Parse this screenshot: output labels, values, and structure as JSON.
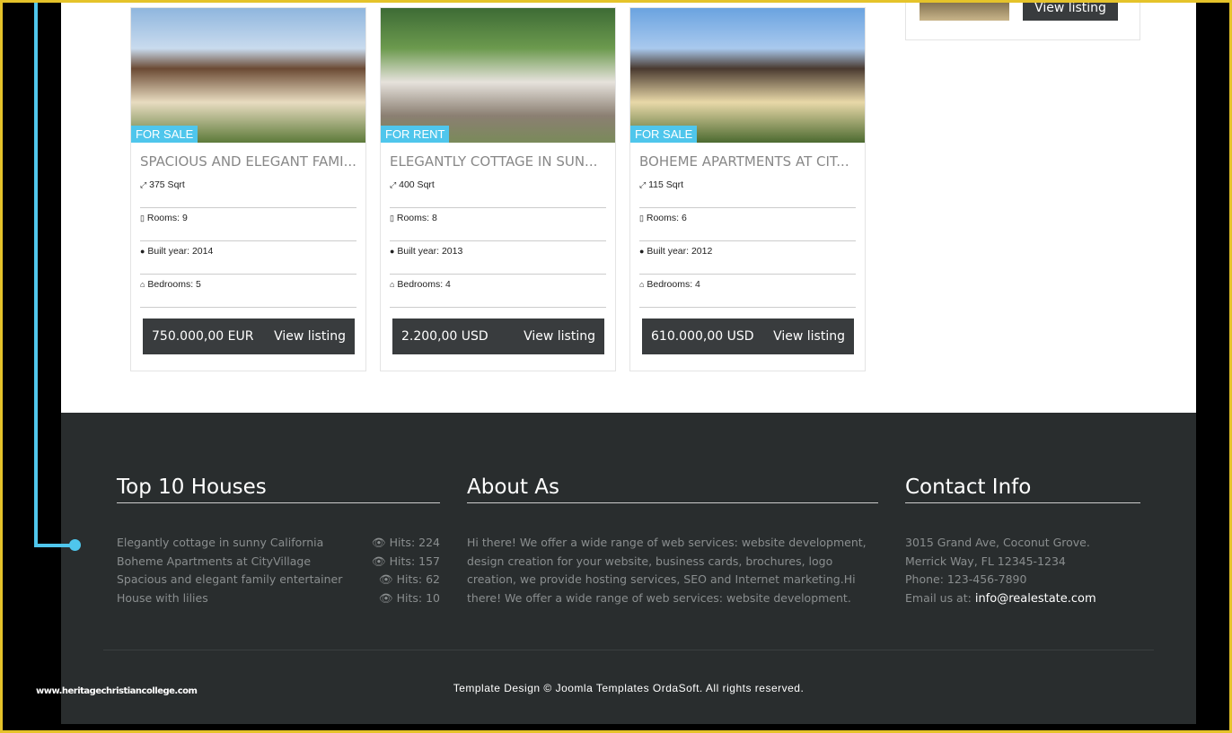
{
  "listings": [
    {
      "badge": "FOR SALE",
      "title": "SPACIOUS AND ELEGANT FAMI...",
      "area": "375 Sqrt",
      "rooms": "Rooms: 9",
      "built": "Built year: 2014",
      "bedrooms": "Bedrooms: 5",
      "price": "750.000,00 EUR",
      "cta": "View listing"
    },
    {
      "badge": "FOR RENT",
      "title": "ELEGANTLY COTTAGE IN SUN...",
      "area": "400 Sqrt",
      "rooms": "Rooms: 8",
      "built": "Built year: 2013",
      "bedrooms": "Bedrooms: 4",
      "price": "2.200,00 USD",
      "cta": "View listing"
    },
    {
      "badge": "FOR SALE",
      "title": "BOHEME APARTMENTS AT CIT...",
      "area": "115 Sqrt",
      "rooms": "Rooms: 6",
      "built": "Built year: 2012",
      "bedrooms": "Bedrooms: 4",
      "price": "610.000,00 USD",
      "cta": "View listing"
    }
  ],
  "sidebar": {
    "cta": "View listing"
  },
  "footer": {
    "top": {
      "title": "Top 10 Houses",
      "items": [
        {
          "name": "Elegantly cottage in sunny California",
          "hits": "Hits: 224"
        },
        {
          "name": "Boheme Apartments at CityVillage",
          "hits": "Hits: 157"
        },
        {
          "name": "Spacious and elegant family entertainer",
          "hits": "Hits: 62"
        },
        {
          "name": "House with lilies",
          "hits": "Hits: 10"
        }
      ]
    },
    "about": {
      "title": "About As",
      "text": "Hi there! We offer a wide range of web services: website development, design creation for your website, business cards, brochures, logo creation, we provide hosting services, SEO and Internet marketing.Hi there! We offer a wide range of web services: website development."
    },
    "contact": {
      "title": "Contact Info",
      "address1": "3015 Grand Ave, Coconut Grove.",
      "address2": "Merrick Way, FL 12345-1234",
      "phone": "Phone: 123-456-7890",
      "email_label": "Email us at:",
      "email": "info@realestate.com"
    },
    "copyright": "Template Design © Joomla Templates OrdaSoft. All rights reserved."
  },
  "watermark": "www.heritagechristiancollege.com",
  "colors": {
    "accent": "#4fc6ec",
    "frame": "#e5c32a",
    "footer": "#292d2e"
  }
}
